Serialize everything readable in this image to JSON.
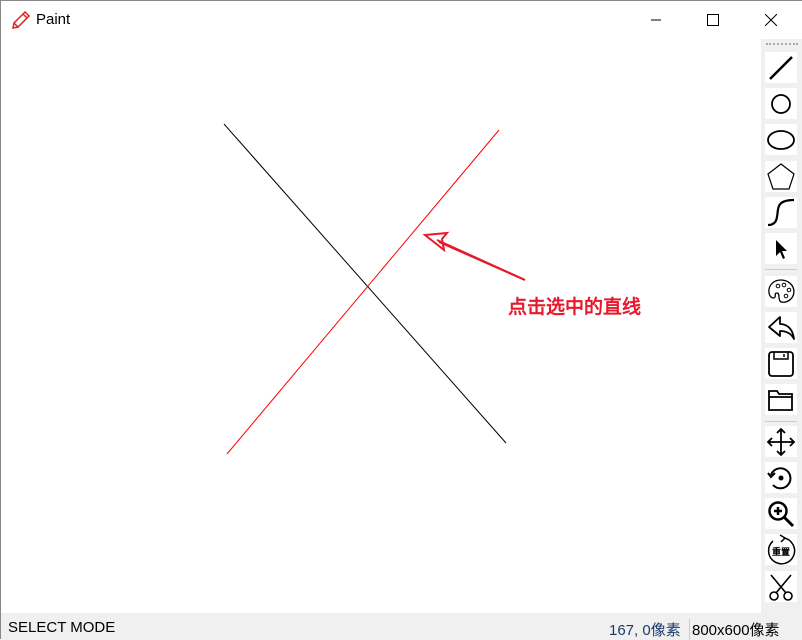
{
  "window": {
    "title": "Paint",
    "icon": "pencil-icon",
    "minimize": "minimize-icon",
    "maximize": "maximize-icon",
    "close": "close-icon"
  },
  "canvas": {
    "annotation": "点击选中的直线",
    "colors": {
      "selected_line": "#ff0000",
      "line": "#000000",
      "annotation": "#e8192c"
    }
  },
  "toolbar": {
    "tools": [
      "line-icon",
      "circle-icon",
      "ellipse-icon",
      "polygon-icon",
      "curve-icon",
      "select-cursor-icon",
      "palette-icon",
      "undo-icon",
      "save-icon",
      "open-folder-icon",
      "move-icon",
      "rotate-icon",
      "zoom-in-icon",
      "reset-icon",
      "cut-icon"
    ],
    "reset_label": "重置"
  },
  "status": {
    "mode": "SELECT MODE",
    "coords": "167, 0像素",
    "size": "800x600像素"
  }
}
